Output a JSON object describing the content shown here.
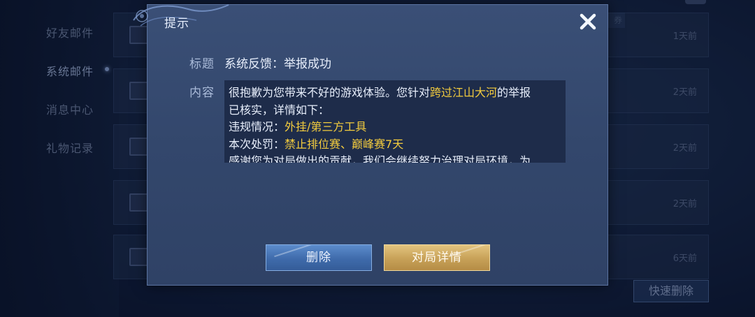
{
  "background": {
    "nav": {
      "items": [
        {
          "label": "好友邮件"
        },
        {
          "label": "系统邮件"
        },
        {
          "label": "消息中心"
        },
        {
          "label": "礼物记录"
        }
      ]
    },
    "mail_rows": [
      {
        "time": "1天前"
      },
      {
        "time": "2天前"
      },
      {
        "time": "2天前"
      },
      {
        "time": "2天前"
      },
      {
        "time": "6天前"
      }
    ],
    "tag_partial": "券",
    "quick_delete_label": "快速删除"
  },
  "dialog": {
    "title": "提示",
    "close_icon": "close-x-icon",
    "subject_label": "标题",
    "subject_value": "系统反馈：举报成功",
    "content_label": "内容",
    "content": {
      "line1_prefix": "很抱歉为您带来不好的游戏体验。您针对",
      "reported_player": "跨过江山大河",
      "line1_suffix": "的举报",
      "line2": "已核实，详情如下：",
      "violation_label": "违规情况：",
      "violation_value": "外挂/第三方工具",
      "penalty_label": "本次处罚：",
      "penalty_value": "禁止排位赛、巅峰赛7天",
      "line5_partial": "感谢您为对局做出的贡献，我们会继续努力治理对局环境，为"
    },
    "delete_button": "删除",
    "match_detail_button": "对局详情"
  },
  "colors": {
    "highlight": "#f2cb3e",
    "dialog_bg": "#33476c",
    "delete_button": "#3f6bab",
    "detail_button": "#c7a158"
  }
}
